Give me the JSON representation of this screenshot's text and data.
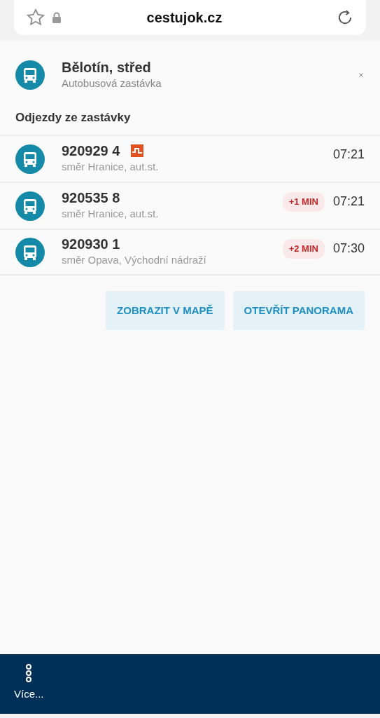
{
  "browser": {
    "url": "cestujok.cz"
  },
  "stop": {
    "name": "Bělotín, střed",
    "type": "Autobusová zastávka"
  },
  "departures_title": "Odjezdy ze zastávky",
  "departures": [
    {
      "line": "920929 4",
      "direction": "směr Hranice, aut.st.",
      "time": "07:21",
      "low_floor": true
    },
    {
      "line": "920535 8",
      "direction": "směr Hranice, aut.st.",
      "time": "07:21",
      "low_floor": false,
      "delay": "+1 MIN"
    },
    {
      "line": "920930 1",
      "direction": "směr Opava, Východní nádraží",
      "time": "07:30",
      "low_floor": false,
      "delay": "+2 MIN"
    }
  ],
  "buttons": [
    "ZOBRAZIT V MAPĚ",
    "OTEVŘÍT PANORAMA"
  ],
  "bottom_nav": {
    "label": "Více..."
  }
}
